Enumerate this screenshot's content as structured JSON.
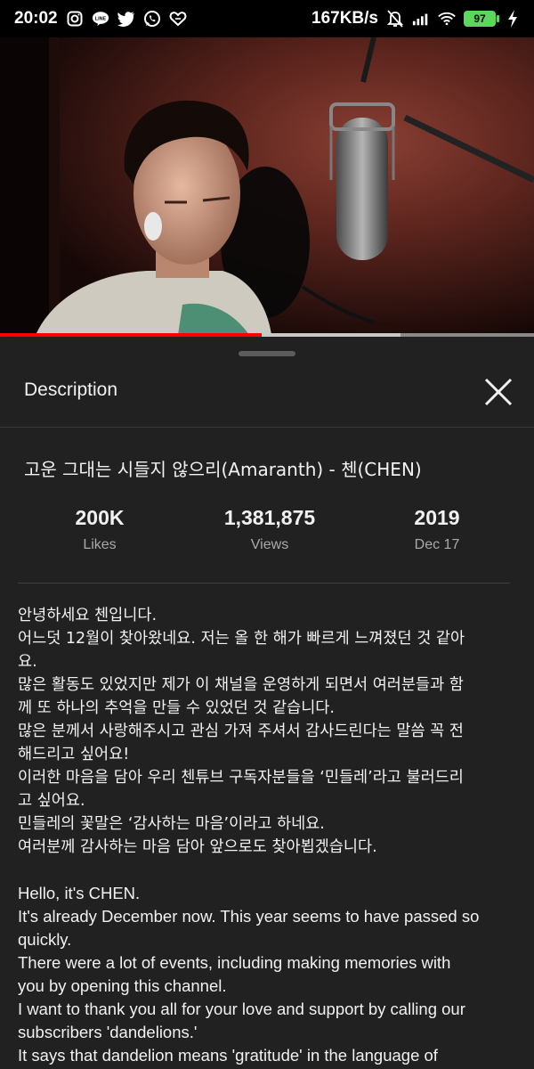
{
  "status_bar": {
    "time": "20:02",
    "net_speed": "167KB/s",
    "battery": "97",
    "left_icons": [
      "instagram-icon",
      "line-icon",
      "twitter-icon",
      "whatsapp-icon",
      "heart-chat-icon"
    ],
    "right_icons": [
      "mute-bell-icon",
      "signal-icon",
      "wifi-icon",
      "battery-icon",
      "charging-icon"
    ]
  },
  "video": {
    "played_fraction": 0.49,
    "buffered_fraction": 0.75,
    "colors": {
      "played": "#ff0000",
      "buffer": "#c8c8c8",
      "track": "#8a8a8a"
    }
  },
  "description_panel": {
    "title": "Description",
    "video_title": "고운 그대는 시들지 않으리(Amaranth) - 첸(CHEN)",
    "stats": [
      {
        "value": "200K",
        "label": "Likes"
      },
      {
        "value": "1,381,875",
        "label": "Views"
      },
      {
        "value": "2019",
        "label": "Dec 17"
      }
    ],
    "body_ko": [
      "안녕하세요 첸입니다.",
      "어느덧 12월이 찾아왔네요. 저는 올 한 해가 빠르게 느껴졌던 것 같아",
      "요.",
      "많은 활동도 있었지만 제가 이 채널을 운영하게 되면서 여러분들과 함",
      "께 또 하나의 추억을 만들 수 있었던 것 같습니다.",
      "많은 분께서 사랑해주시고 관심 가져 주셔서 감사드린다는 말씀 꼭 전",
      "해드리고 싶어요!",
      "이러한 마음을 담아 우리 첸튜브 구독자분들을 ‘민들레’라고 불러드리",
      "고 싶어요.",
      "민들레의 꽃말은 ‘감사하는 마음’이라고 하네요.",
      "여러분께 감사하는 마음 담아 앞으로도 찾아뵙겠습니다."
    ],
    "body_en": [
      "Hello, it's CHEN.",
      "It's already December now. This year seems to have passed so",
      "quickly.",
      "There were a lot of events, including making memories with",
      "you by opening this channel.",
      "I want to thank you all for your love and support by calling our",
      "subscribers 'dandelions.'",
      "It says that dandelion means 'gratitude' in the language of"
    ]
  }
}
